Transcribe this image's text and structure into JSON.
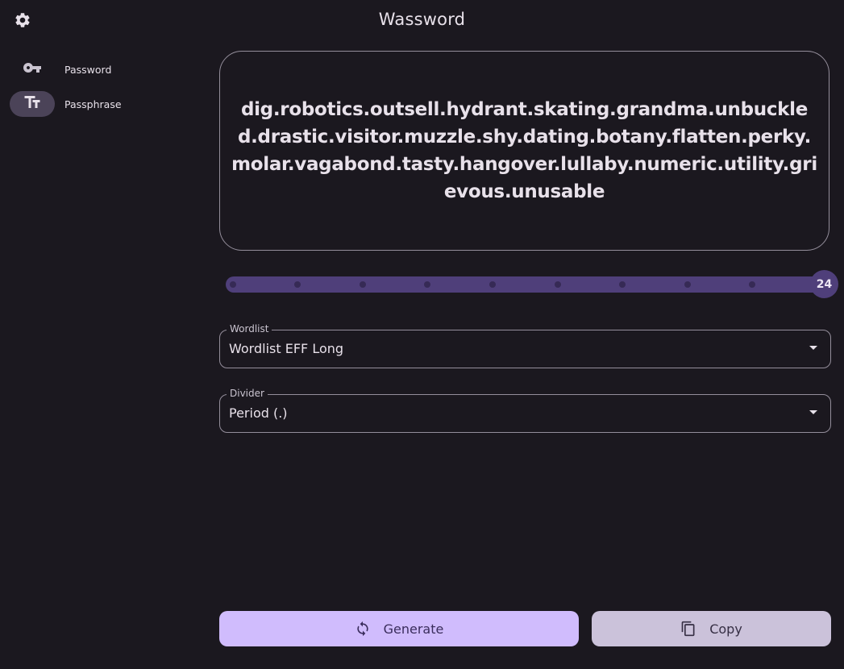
{
  "app": {
    "title": "Wassword"
  },
  "sidebar": {
    "items": [
      {
        "label": "Password",
        "icon": "key-icon",
        "active": false
      },
      {
        "label": "Passphrase",
        "icon": "text-fields-icon",
        "active": true
      }
    ]
  },
  "output": {
    "passphrase": "dig.robotics.outsell.hydrant.skating.grandma.unbuckled.drastic.visitor.muzzle.shy.dating.botany.flatten.perky.molar.vagabond.tasty.hangover.lullaby.numeric.utility.grievous.unusable"
  },
  "slider": {
    "value": "24",
    "fraction": 1.0
  },
  "wordlist": {
    "label": "Wordlist",
    "value": "Wordlist EFF Long"
  },
  "divider": {
    "label": "Divider",
    "value": "Period (.)"
  },
  "actions": {
    "generate_label": "Generate",
    "copy_label": "Copy"
  },
  "colors": {
    "background": "#1b181f",
    "primary": "#d0bcfd",
    "slider_active": "#4f3f7a",
    "secondary_button": "#cbc2da"
  }
}
